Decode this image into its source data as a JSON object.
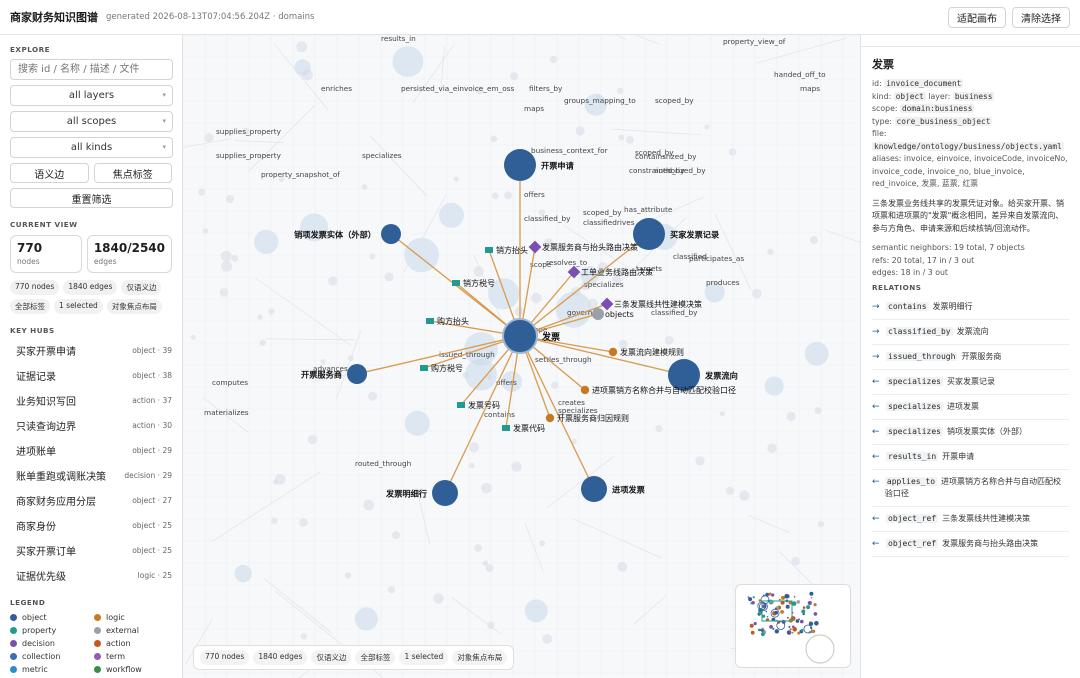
{
  "header": {
    "title": "商家财务知识图谱",
    "generated": "generated 2026-08-13T07:04:56.204Z · domains",
    "fit_label": "适配画布",
    "clear_label": "清除选择"
  },
  "sidebar": {
    "explore_label": "EXPLORE",
    "search_placeholder": "搜索 id / 名称 / 描述 / 文件",
    "layers": "all layers",
    "scopes": "all scopes",
    "kinds": "all kinds",
    "semantic_edges": "语义边",
    "focus_tags": "焦点标签",
    "reset": "重置筛选",
    "current_view_label": "CURRENT VIEW",
    "nodes_value": "770",
    "nodes_label": "nodes",
    "edges_value": "1840/2540",
    "edges_label": "edges",
    "chips": [
      "770 nodes",
      "1840 edges",
      "仅语义边",
      "全部标签",
      "1 selected",
      "对象焦点布局"
    ],
    "key_hubs_label": "KEY HUBS",
    "hubs": [
      {
        "name": "买家开票申请",
        "meta": "object · 39"
      },
      {
        "name": "证据记录",
        "meta": "object · 38"
      },
      {
        "name": "业务知识写回",
        "meta": "action · 37"
      },
      {
        "name": "只读查询边界",
        "meta": "action · 30"
      },
      {
        "name": "进项账单",
        "meta": "object · 29"
      },
      {
        "name": "账单重跑或调账决策",
        "meta": "decision · 29"
      },
      {
        "name": "商家财务应用分层",
        "meta": "object · 27"
      },
      {
        "name": "商家身份",
        "meta": "object · 25"
      },
      {
        "name": "买家开票订单",
        "meta": "object · 25"
      },
      {
        "name": "证据优先级",
        "meta": "logic · 25"
      }
    ],
    "legend_label": "LEGEND",
    "legend": [
      {
        "name": "object",
        "color": "#2f5f96"
      },
      {
        "name": "logic",
        "color": "#c87a23"
      },
      {
        "name": "property",
        "color": "#239a8f"
      },
      {
        "name": "external",
        "color": "#9aa0a8"
      },
      {
        "name": "decision",
        "color": "#7a4fb2"
      },
      {
        "name": "action",
        "color": "#c8561f"
      },
      {
        "name": "collection",
        "color": "#3d6fb0"
      },
      {
        "name": "term",
        "color": "#8e5cc0"
      },
      {
        "name": "metric",
        "color": "#2c8fc4"
      },
      {
        "name": "workflow",
        "color": "#3c8a4e"
      }
    ]
  },
  "graph": {
    "center_label": "发票",
    "nodes": [
      {
        "label": "开票申请",
        "kind": "object"
      },
      {
        "label": "买家发票记录",
        "kind": "object"
      },
      {
        "label": "销项发票实体（外部）",
        "kind": "object"
      },
      {
        "label": "开票服务商",
        "kind": "object"
      },
      {
        "label": "发票流向",
        "kind": "object"
      },
      {
        "label": "发票明细行",
        "kind": "object"
      },
      {
        "label": "进项发票",
        "kind": "object"
      },
      {
        "label": "objects",
        "kind": "external"
      },
      {
        "label": "发票服务商与抬头路由决策",
        "kind": "decision"
      },
      {
        "label": "工单业务线路由决策",
        "kind": "decision"
      },
      {
        "label": "三条发票线共性建模决策",
        "kind": "decision"
      },
      {
        "label": "销方抬头",
        "kind": "property"
      },
      {
        "label": "销方税号",
        "kind": "property"
      },
      {
        "label": "购方抬头",
        "kind": "property"
      },
      {
        "label": "购方税号",
        "kind": "property"
      },
      {
        "label": "发票号码",
        "kind": "property"
      },
      {
        "label": "发票代码",
        "kind": "property"
      },
      {
        "label": "发票流向建模规则",
        "kind": "logic"
      },
      {
        "label": "进项票销方名称合并与自动匹配校验口径",
        "kind": "logic"
      },
      {
        "label": "开票服务商归因规则",
        "kind": "logic"
      }
    ],
    "edge_labels": [
      "results_in",
      "property_view_of",
      "handed_off_to",
      "maps",
      "enriches",
      "persisted_via_einvoice_em_oss",
      "filters_by",
      "groups_mapping_to",
      "scoped_by",
      "maps",
      "supplies_property",
      "specializes",
      "business_context_for",
      "scoped_by",
      "containsrized_by",
      "supplies_property",
      "property_snapshot_of",
      "constrained_by",
      "authorized_by",
      "offers",
      "scope",
      "classified_by",
      "scoped_by",
      "has_attribute",
      "classifiedrives",
      "participates_as",
      "resolves_to",
      "classified",
      "targets",
      "produces",
      "specializes",
      "governs",
      "classified_by",
      "scope",
      "issued_through",
      "settles_through",
      "advances_st",
      "computes",
      "materializes",
      "contains",
      "creates",
      "specializes",
      "routed_through",
      "offers"
    ]
  },
  "bottom_chips": [
    "770 nodes",
    "1840 edges",
    "仅语义边",
    "全部标签",
    "1 selected",
    "对象焦点布局"
  ],
  "detail": {
    "title": "发票",
    "id_label": "id:",
    "id": "invoice_document",
    "kind_label": "kind:",
    "kind": "object",
    "layer_label": "layer:",
    "layer": "business",
    "scope_label": "scope:",
    "scope": "domain:business",
    "type_label": "type:",
    "type": "core_business_object",
    "file_label": "file:",
    "file": "knowledge/ontology/business/objects.yaml",
    "aliases": "aliases: invoice, einvoice, invoiceCode, invoiceNo, invoice_code, invoice_no, blue_invoice, red_invoice, 发票, 蓝票, 红票",
    "description": "三条发票业务线共享的发票凭证对象。给买家开票、销项票和进项票的\"发票\"概念相同，差异来自发票流向、参与方角色、申请来源和后续核销/回流动作。",
    "neighbors": "semantic neighbors: 19 total, 7 objects",
    "refs": "refs: 20 total, 17 in / 3 out",
    "edges": "edges: 18 in / 3 out",
    "relations_label": "RELATIONS",
    "relations": [
      {
        "dir": "→",
        "type": "contains",
        "target": "发票明细行"
      },
      {
        "dir": "→",
        "type": "classified_by",
        "target": "发票流向"
      },
      {
        "dir": "→",
        "type": "issued_through",
        "target": "开票服务商"
      },
      {
        "dir": "←",
        "type": "specializes",
        "target": "买家发票记录"
      },
      {
        "dir": "←",
        "type": "specializes",
        "target": "进项发票"
      },
      {
        "dir": "←",
        "type": "specializes",
        "target": "销项发票实体（外部）"
      },
      {
        "dir": "←",
        "type": "results_in",
        "target": "开票申请"
      },
      {
        "dir": "←",
        "type": "applies_to",
        "target": "进项票销方名称合并与自动匹配校验口径"
      },
      {
        "dir": "←",
        "type": "object_ref",
        "target": "三条发票线共性建模决策"
      },
      {
        "dir": "←",
        "type": "object_ref",
        "target": "发票服务商与抬头路由决策"
      }
    ]
  }
}
